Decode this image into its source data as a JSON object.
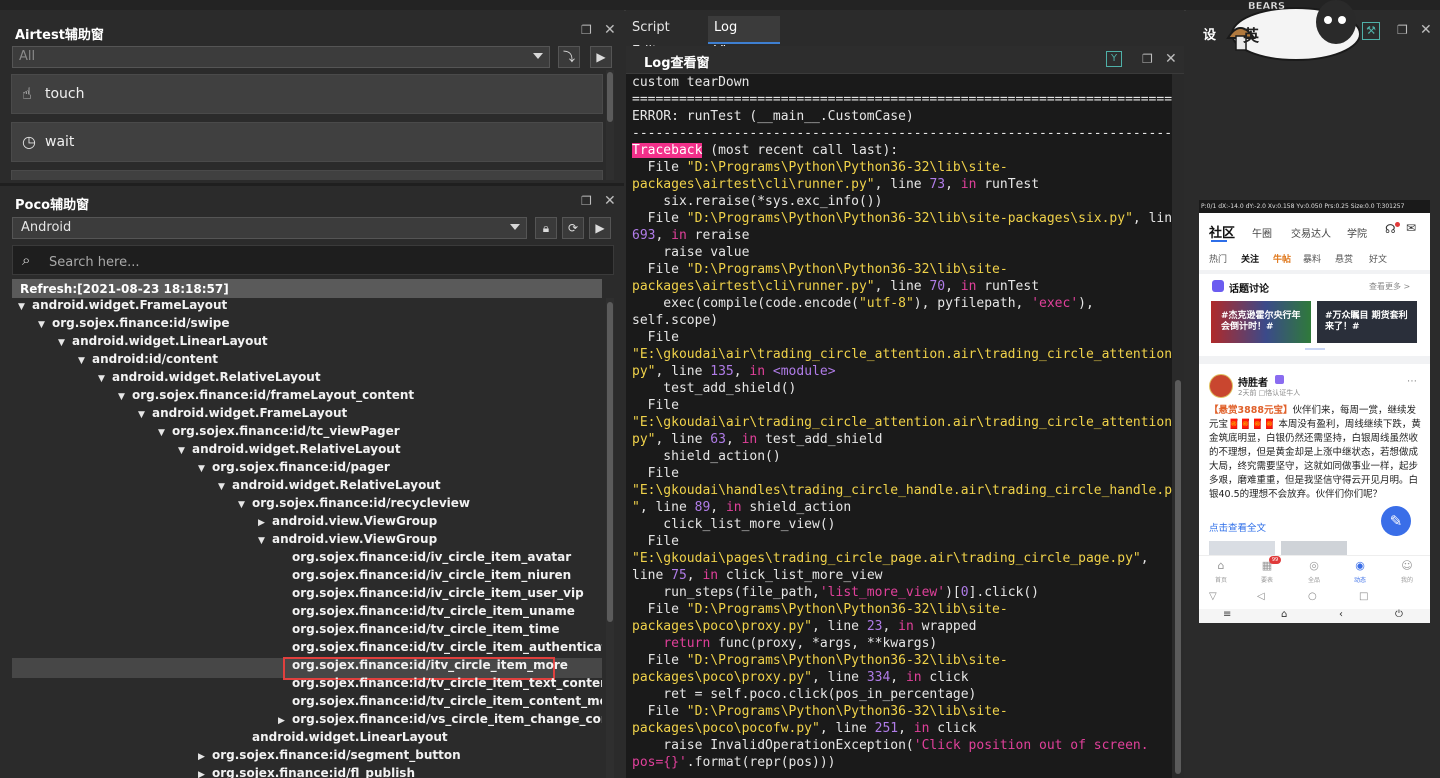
{
  "airtest_panel": {
    "title": "Airtest辅助窗",
    "filter_value": "All",
    "actions": [
      {
        "icon": "touch-hand-icon",
        "label": "touch"
      },
      {
        "icon": "clock-icon",
        "label": "wait"
      }
    ]
  },
  "poco_panel": {
    "title": "Poco辅助窗",
    "platform_value": "Android",
    "search_placeholder": "Search here...",
    "refresh_label": "Refresh:[2021-08-23 18:18:57]",
    "tree": [
      {
        "label": "android.widget.FrameLayout",
        "depth": 0,
        "expanded": true
      },
      {
        "label": "org.sojex.finance:id/swipe",
        "depth": 1,
        "expanded": true
      },
      {
        "label": "android.widget.LinearLayout",
        "depth": 2,
        "expanded": true
      },
      {
        "label": "android:id/content",
        "depth": 3,
        "expanded": true
      },
      {
        "label": "android.widget.RelativeLayout",
        "depth": 4,
        "expanded": true
      },
      {
        "label": "org.sojex.finance:id/frameLayout_content",
        "depth": 5,
        "expanded": true
      },
      {
        "label": "android.widget.FrameLayout",
        "depth": 6,
        "expanded": true
      },
      {
        "label": "org.sojex.finance:id/tc_viewPager",
        "depth": 7,
        "expanded": true
      },
      {
        "label": "android.widget.RelativeLayout",
        "depth": 8,
        "expanded": true
      },
      {
        "label": "org.sojex.finance:id/pager",
        "depth": 9,
        "expanded": true
      },
      {
        "label": "android.widget.RelativeLayout",
        "depth": 10,
        "expanded": true
      },
      {
        "label": "org.sojex.finance:id/recycleview",
        "depth": 11,
        "expanded": true
      },
      {
        "label": "android.view.ViewGroup",
        "depth": 12,
        "expanded": false
      },
      {
        "label": "android.view.ViewGroup",
        "depth": 12,
        "expanded": true
      },
      {
        "label": "org.sojex.finance:id/iv_circle_item_avatar",
        "depth": 13,
        "leaf": true
      },
      {
        "label": "org.sojex.finance:id/iv_circle_item_niuren",
        "depth": 13,
        "leaf": true
      },
      {
        "label": "org.sojex.finance:id/iv_circle_item_user_vip",
        "depth": 13,
        "leaf": true
      },
      {
        "label": "org.sojex.finance:id/tv_circle_item_uname",
        "depth": 13,
        "leaf": true
      },
      {
        "label": "org.sojex.finance:id/tv_circle_item_time",
        "depth": 13,
        "leaf": true
      },
      {
        "label": "org.sojex.finance:id/tv_circle_item_authentication",
        "depth": 13,
        "leaf": true
      },
      {
        "label": "org.sojex.finance:id/itv_circle_item_more",
        "depth": 13,
        "leaf": true,
        "selected": true
      },
      {
        "label": "org.sojex.finance:id/tv_circle_item_text_content",
        "depth": 13,
        "leaf": true
      },
      {
        "label": "org.sojex.finance:id/tv_circle_item_content_more",
        "depth": 13,
        "leaf": true
      },
      {
        "label": "org.sojex.finance:id/vs_circle_item_change_cont...",
        "depth": 13,
        "expanded": false
      },
      {
        "label": "android.widget.LinearLayout",
        "depth": 11,
        "leaf": true
      },
      {
        "label": "org.sojex.finance:id/segment_button",
        "depth": 9,
        "expanded": false
      },
      {
        "label": "org.sojex.finance:id/fl_publish",
        "depth": 9,
        "expanded": false
      }
    ]
  },
  "editor_tabs": [
    {
      "label": "Script Editor",
      "active": false
    },
    {
      "label": "Log Viewer",
      "active": true
    }
  ],
  "log_panel": {
    "title": "Log查看窗",
    "lines": [
      [
        {
          "t": "custom tearDown"
        }
      ],
      [
        {
          "t": "======================================================================"
        }
      ],
      [
        {
          "t": "ERROR: runTest (__main__.CustomCase)"
        }
      ],
      [
        {
          "t": "----------------------------------------------------------------------"
        }
      ],
      [
        {
          "t": "Traceback",
          "c": "tb-mark"
        },
        {
          "t": " (most recent call last):"
        }
      ],
      [
        {
          "t": "  File "
        },
        {
          "t": "\"D:\\Programs\\Python\\Python36-32\\lib\\site-",
          "c": "str"
        }
      ],
      [
        {
          "t": "packages\\airtest\\cli\\runner.py\"",
          "c": "str"
        },
        {
          "t": ", line "
        },
        {
          "t": "73",
          "c": "purple"
        },
        {
          "t": ", "
        },
        {
          "t": "in",
          "c": "kw"
        },
        {
          "t": " runTest"
        }
      ],
      [
        {
          "t": "    six.reraise(*sys.exc_info())"
        }
      ],
      [
        {
          "t": "  File "
        },
        {
          "t": "\"D:\\Programs\\Python\\Python36-32\\lib\\site-packages\\six.py\"",
          "c": "str"
        },
        {
          "t": ", line"
        }
      ],
      [
        {
          "t": "693",
          "c": "purple"
        },
        {
          "t": ", "
        },
        {
          "t": "in",
          "c": "kw"
        },
        {
          "t": " reraise"
        }
      ],
      [
        {
          "t": "    raise value"
        }
      ],
      [
        {
          "t": "  File "
        },
        {
          "t": "\"D:\\Programs\\Python\\Python36-32\\lib\\site-",
          "c": "str"
        }
      ],
      [
        {
          "t": "packages\\airtest\\cli\\runner.py\"",
          "c": "str"
        },
        {
          "t": ", line "
        },
        {
          "t": "70",
          "c": "purple"
        },
        {
          "t": ", "
        },
        {
          "t": "in",
          "c": "kw"
        },
        {
          "t": " runTest"
        }
      ],
      [
        {
          "t": "    exec(compile(code.encode("
        },
        {
          "t": "\"utf-8\"",
          "c": "str"
        },
        {
          "t": "), pyfilepath, "
        },
        {
          "t": "'exec'",
          "c": "kw"
        },
        {
          "t": "),"
        }
      ],
      [
        {
          "t": "self.scope)"
        }
      ],
      [
        {
          "t": "  File"
        }
      ],
      [
        {
          "t": "\"E:\\gkoudai\\air\\trading_circle_attention.air\\trading_circle_attention.",
          "c": "str"
        }
      ],
      [
        {
          "t": "py\"",
          "c": "str"
        },
        {
          "t": ", line "
        },
        {
          "t": "135",
          "c": "purple"
        },
        {
          "t": ", "
        },
        {
          "t": "in",
          "c": "kw"
        },
        {
          "t": " "
        },
        {
          "t": "<module>",
          "c": "purple"
        }
      ],
      [
        {
          "t": "    test_add_shield()"
        }
      ],
      [
        {
          "t": "  File"
        }
      ],
      [
        {
          "t": "\"E:\\gkoudai\\air\\trading_circle_attention.air\\trading_circle_attention.",
          "c": "str"
        }
      ],
      [
        {
          "t": "py\"",
          "c": "str"
        },
        {
          "t": ", line "
        },
        {
          "t": "63",
          "c": "purple"
        },
        {
          "t": ", "
        },
        {
          "t": "in",
          "c": "kw"
        },
        {
          "t": " test_add_shield"
        }
      ],
      [
        {
          "t": "    shield_action()"
        }
      ],
      [
        {
          "t": "  File"
        }
      ],
      [
        {
          "t": "\"E:\\gkoudai\\handles\\trading_circle_handle.air\\trading_circle_handle.py",
          "c": "str"
        }
      ],
      [
        {
          "t": "\"",
          "c": "str"
        },
        {
          "t": ", line "
        },
        {
          "t": "89",
          "c": "purple"
        },
        {
          "t": ", "
        },
        {
          "t": "in",
          "c": "kw"
        },
        {
          "t": " shield_action"
        }
      ],
      [
        {
          "t": "    click_list_more_view()"
        }
      ],
      [
        {
          "t": "  File"
        }
      ],
      [
        {
          "t": "\"E:\\gkoudai\\pages\\trading_circle_page.air\\trading_circle_page.py\"",
          "c": "str"
        },
        {
          "t": ","
        }
      ],
      [
        {
          "t": "line "
        },
        {
          "t": "75",
          "c": "purple"
        },
        {
          "t": ", "
        },
        {
          "t": "in",
          "c": "kw"
        },
        {
          "t": " click_list_more_view"
        }
      ],
      [
        {
          "t": "    run_steps(file_path,"
        },
        {
          "t": "'list_more_view'",
          "c": "kw"
        },
        {
          "t": ")["
        },
        {
          "t": "0",
          "c": "purple"
        },
        {
          "t": "].click()"
        }
      ],
      [
        {
          "t": "  File "
        },
        {
          "t": "\"D:\\Programs\\Python\\Python36-32\\lib\\site-",
          "c": "str"
        }
      ],
      [
        {
          "t": "packages\\poco\\proxy.py\"",
          "c": "str"
        },
        {
          "t": ", line "
        },
        {
          "t": "23",
          "c": "purple"
        },
        {
          "t": ", "
        },
        {
          "t": "in",
          "c": "kw"
        },
        {
          "t": " wrapped"
        }
      ],
      [
        {
          "t": "    "
        },
        {
          "t": "return",
          "c": "kw"
        },
        {
          "t": " func(proxy, *args, **kwargs)"
        }
      ],
      [
        {
          "t": "  File "
        },
        {
          "t": "\"D:\\Programs\\Python\\Python36-32\\lib\\site-",
          "c": "str"
        }
      ],
      [
        {
          "t": "packages\\poco\\proxy.py\"",
          "c": "str"
        },
        {
          "t": ", line "
        },
        {
          "t": "334",
          "c": "purple"
        },
        {
          "t": ", "
        },
        {
          "t": "in",
          "c": "kw"
        },
        {
          "t": " click"
        }
      ],
      [
        {
          "t": "    ret = self.poco.click(pos_in_percentage)"
        }
      ],
      [
        {
          "t": "  File "
        },
        {
          "t": "\"D:\\Programs\\Python\\Python36-32\\lib\\site-",
          "c": "str"
        }
      ],
      [
        {
          "t": "packages\\poco\\pocofw.py\"",
          "c": "str"
        },
        {
          "t": ", line "
        },
        {
          "t": "251",
          "c": "purple"
        },
        {
          "t": ", "
        },
        {
          "t": "in",
          "c": "kw"
        },
        {
          "t": " click"
        }
      ],
      [
        {
          "t": "    raise InvalidOperationException("
        },
        {
          "t": "'Click position out of screen.",
          "c": "kw"
        }
      ],
      [
        {
          "t": "pos={}'",
          "c": "kw"
        },
        {
          "t": ".format(repr(pos)))"
        }
      ]
    ]
  },
  "device_panel": {
    "title_partial": "设",
    "ime_label": "英",
    "phone": {
      "status_bar": "P:0/1  dX:-14.0  dY:-2.0  Xv:0.158 Yv:0.050  Prs:0.25  Size:0.0  T:301257",
      "tabs": [
        "社区",
        "午圈",
        "交易达人",
        "学院"
      ],
      "subtabs": [
        "热门",
        "关注",
        "牛帖",
        "暴料",
        "悬赏",
        "好文"
      ],
      "topic_title": "话题讨论",
      "topic_more": "查看更多 >",
      "topic_cards": [
        "#杰克逊霍尔央行年会倒计时！#",
        "#万众瞩目 期货套利来了！#"
      ],
      "post_user": "持胜者",
      "post_meta": "2天前  □恪认证牛人",
      "post_bounty": "【悬赏3888元宝】",
      "post_text": "伙伴们来，每周一赏，继续发元宝🧧🧧🧧🧧 本周没有盈利，周线继续下跌，黄金筑底明显，白银仍然还需坚持，白银周线虽然收的不理想，但是黄金却是上涨中继状态，若想做成大局，终究需要坚守，这就如同做事业一样，起步多艰，磨难重重，但是我坚信守得云开见月明。白银40.5的理想不会放弃。伙伴们你们呢？",
      "post_read_more": "点击查看全文",
      "nav": [
        "首页",
        "要表",
        "全品",
        "动态",
        "我的"
      ],
      "nav_badge": "99",
      "sys_nav": [
        "▽",
        "◁",
        "○",
        "□"
      ],
      "bottom_bar": [
        "≡",
        "⌂",
        "‹",
        "⏻"
      ]
    }
  }
}
